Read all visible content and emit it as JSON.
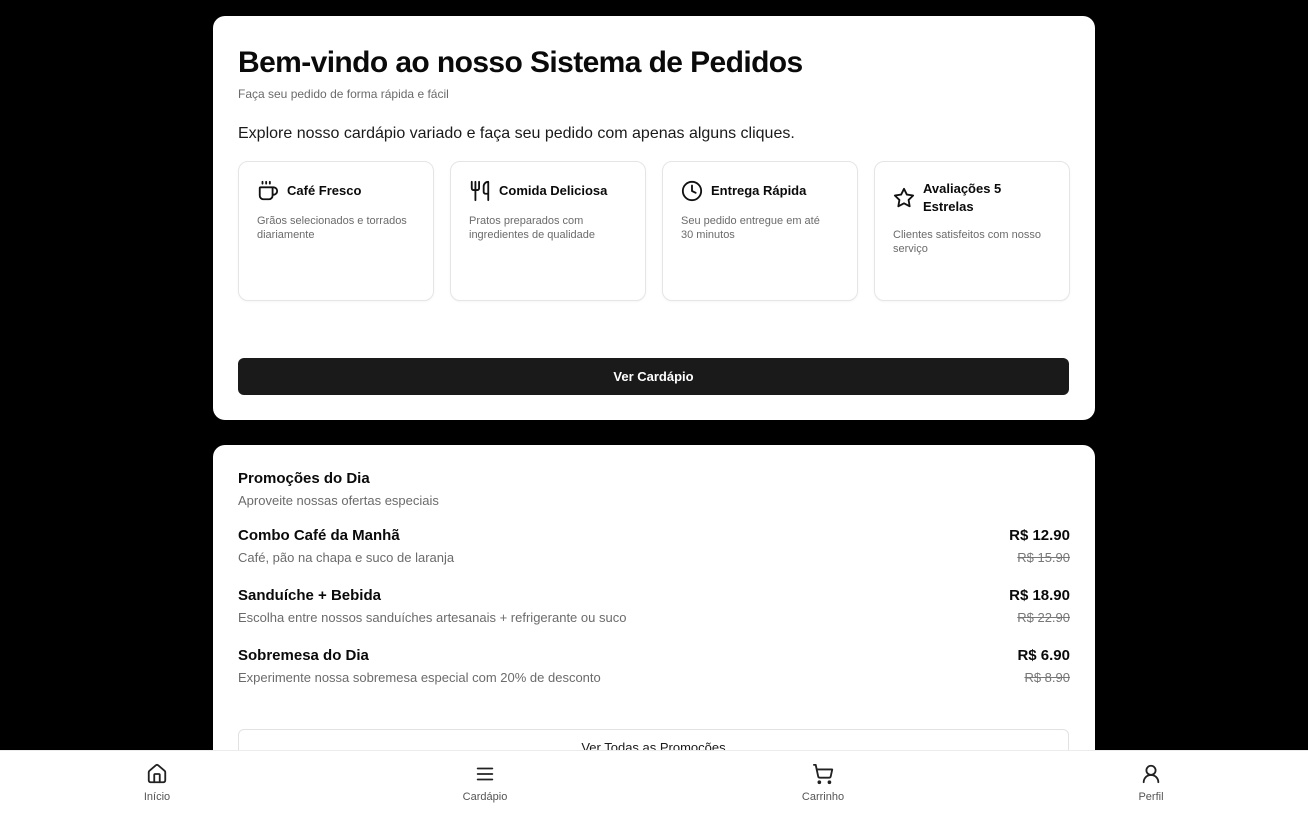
{
  "hero": {
    "title": "Bem-vindo ao nosso Sistema de Pedidos",
    "subtitle": "Faça seu pedido de forma rápida e fácil",
    "intro": "Explore nosso cardápio variado e faça seu pedido com apenas alguns cliques.",
    "features": [
      {
        "icon": "coffee-cup-icon",
        "title": "Café Fresco",
        "description": "Grãos selecionados e torrados diariamente"
      },
      {
        "icon": "utensils-icon",
        "title": "Comida Deliciosa",
        "description": "Pratos preparados com ingredientes de qualidade"
      },
      {
        "icon": "clock-icon",
        "title": "Entrega Rápida",
        "description": "Seu pedido entregue em até 30 minutos"
      },
      {
        "icon": "star-icon",
        "title": "Avaliações 5 Estrelas",
        "description": "Clientes satisfeitos com nosso serviço"
      }
    ],
    "cta_label": "Ver Cardápio"
  },
  "promotions": {
    "title": "Promoções do Dia",
    "subtitle": "Aproveite nossas ofertas especiais",
    "items": [
      {
        "name": "Combo Café da Manhã",
        "description": "Café, pão na chapa e suco de laranja",
        "price": "R$ 12.90",
        "old_price": "R$ 15.90"
      },
      {
        "name": "Sanduíche + Bebida",
        "description": "Escolha entre nossos sanduíches artesanais + refrigerante ou suco",
        "price": "R$ 18.90",
        "old_price": "R$ 22.90"
      },
      {
        "name": "Sobremesa do Dia",
        "description": "Experimente nossa sobremesa especial com 20% de desconto",
        "price": "R$ 6.90",
        "old_price": "R$ 8.90"
      }
    ],
    "see_all_label": "Ver Todas as Promoções"
  },
  "nav": {
    "items": [
      {
        "icon": "home-icon",
        "label": "Início"
      },
      {
        "icon": "menu-icon",
        "label": "Cardápio"
      },
      {
        "icon": "cart-icon",
        "label": "Carrinho"
      },
      {
        "icon": "user-icon",
        "label": "Perfil"
      }
    ]
  },
  "colors": {
    "background": "#000000",
    "card": "#ffffff",
    "primary_button": "#1a1a1a",
    "muted_text": "#6b6b6b"
  }
}
